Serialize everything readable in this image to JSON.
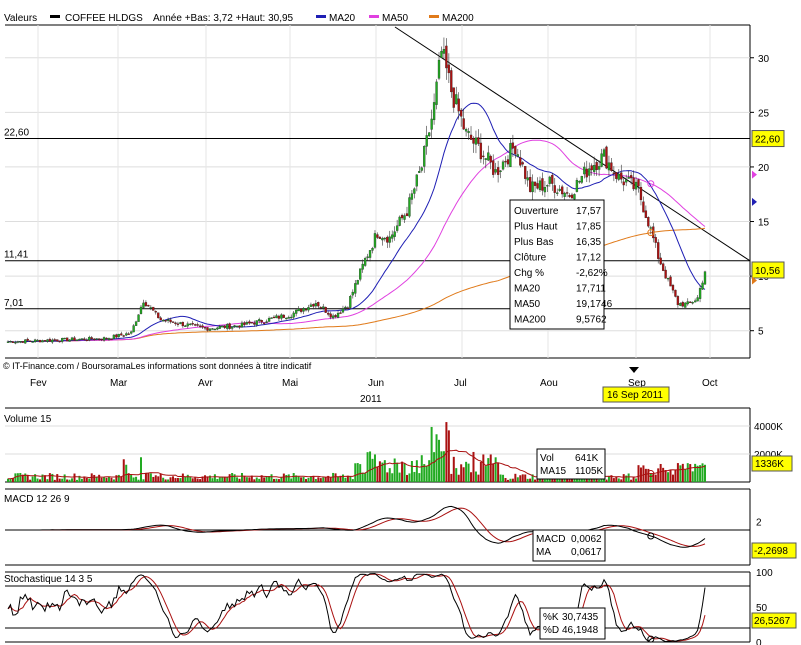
{
  "chart_data": [
    {
      "type": "candlestick",
      "header": {
        "valeurs": "Valeurs",
        "name": "COFFEE HLDGS",
        "range_text": "Année +Bas: 3,72 +Haut: 30,95",
        "legend": [
          {
            "name": "MA20",
            "color": "#1f1fb4"
          },
          {
            "name": "MA50",
            "color": "#e040e0"
          },
          {
            "name": "MA200",
            "color": "#e07a1a"
          }
        ]
      },
      "ylim": [
        2.5,
        33
      ],
      "yticks": [
        5,
        10,
        15,
        20,
        25,
        30
      ],
      "ytick_labels": [
        "5",
        "10",
        "15",
        "20",
        "25",
        "30"
      ],
      "levels": [
        {
          "value": 22.6,
          "label": "22,60"
        },
        {
          "value": 11.41,
          "label": "11,41"
        },
        {
          "value": 7.01,
          "label": "7,01"
        }
      ],
      "right_badges": [
        {
          "value": 22.6,
          "label": "22,60",
          "bg": "#ffff00"
        },
        {
          "value": 10.56,
          "label": "10,56",
          "bg": "#ffff00"
        }
      ],
      "months": [
        "Fev",
        "Mar",
        "Avr",
        "Mai",
        "Jun",
        "Jul",
        "Aou",
        "Sep",
        "Oct"
      ],
      "year": "2011",
      "credit": "© IT-Finance.com / BoursoramaLes informations sont données à titre indicatif",
      "date_badge": "16 Sep 2011",
      "colors": {
        "up": "#22aa22",
        "down": "#aa1111",
        "ma20": "#1f1fb4",
        "ma50": "#e040e0",
        "ma200": "#e07a1a",
        "trend": "#000000"
      },
      "anchors": [
        [
          0,
          4.0
        ],
        [
          40,
          4.3
        ],
        [
          50,
          4.8
        ],
        [
          55,
          7.8
        ],
        [
          62,
          6.0
        ],
        [
          80,
          5.2
        ],
        [
          95,
          5.5
        ],
        [
          115,
          6.5
        ],
        [
          125,
          7.6
        ],
        [
          132,
          6.3
        ],
        [
          138,
          7.4
        ],
        [
          145,
          11.5
        ],
        [
          150,
          14.0
        ],
        [
          155,
          13.5
        ],
        [
          162,
          16.0
        ],
        [
          168,
          20.0
        ],
        [
          173,
          25.5
        ],
        [
          176,
          30.5
        ],
        [
          180,
          27.0
        ],
        [
          186,
          23.0
        ],
        [
          192,
          21.5
        ],
        [
          198,
          19.5
        ],
        [
          206,
          22.0
        ],
        [
          212,
          18.0
        ],
        [
          220,
          18.5
        ],
        [
          228,
          17.5
        ],
        [
          236,
          20.0
        ],
        [
          242,
          21.0
        ],
        [
          248,
          19.0
        ],
        [
          252,
          18.5
        ],
        [
          256,
          17.8
        ],
        [
          260,
          15.0
        ],
        [
          264,
          11.8
        ],
        [
          268,
          9.5
        ],
        [
          272,
          7.5
        ],
        [
          276,
          7.4
        ],
        [
          280,
          8.0
        ],
        [
          283,
          10.5
        ]
      ],
      "tooltip": [
        {
          "k": "Ouverture",
          "v": "17,57",
          "c": "#000000"
        },
        {
          "k": "Plus Haut",
          "v": "17,85",
          "c": "#000000"
        },
        {
          "k": "Plus Bas",
          "v": "16,35",
          "c": "#000000"
        },
        {
          "k": "Clôture",
          "v": "17,12",
          "c": "#000000"
        },
        {
          "k": "Chg %",
          "v": "-2,62%",
          "c": "#ff0000"
        },
        {
          "k": "MA20",
          "v": "17,711",
          "c": "#1f1fb4"
        },
        {
          "k": "MA50",
          "v": "19,1746",
          "c": "#e040e0"
        },
        {
          "k": "MA200",
          "v": "9,5762",
          "c": "#e07a1a"
        }
      ]
    },
    {
      "type": "bar",
      "title": "Volume 15",
      "yticks": [
        2000,
        4000
      ],
      "ytick_labels": [
        "2000K",
        "4000K"
      ],
      "badge": "1336K",
      "tooltip": [
        {
          "k": "Vol",
          "v": "641K",
          "c": "#000000"
        },
        {
          "k": "MA15",
          "v": "1105K",
          "c": "#aa1111"
        }
      ]
    },
    {
      "type": "line",
      "title": "MACD 12 26 9",
      "yticks": [
        2
      ],
      "ytick_labels": [
        "2"
      ],
      "badge": "-2,2698",
      "tooltip": [
        {
          "k": "MACD",
          "v": "0,0062",
          "c": "#000000"
        },
        {
          "k": "MA",
          "v": "0,0617",
          "c": "#aa1111"
        }
      ]
    },
    {
      "type": "line",
      "title": "Stochastique 14 3 5",
      "yticks": [
        0,
        50,
        100
      ],
      "ytick_labels": [
        "0",
        "50",
        "100"
      ],
      "badge": "26,5267",
      "tooltip": [
        {
          "k": "%K",
          "v": "30,7435",
          "c": "#000000"
        },
        {
          "k": "%D",
          "v": "46,1948",
          "c": "#aa1111"
        }
      ]
    }
  ]
}
